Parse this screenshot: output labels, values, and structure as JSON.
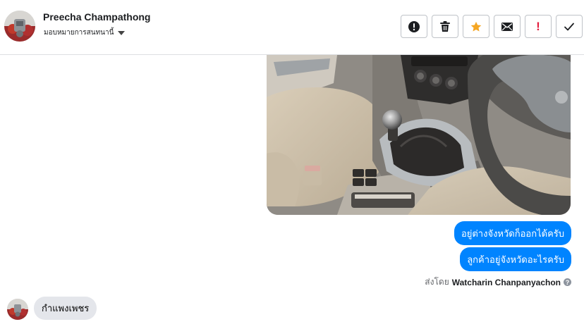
{
  "header": {
    "contact_name": "Preecha Champathong",
    "assign_label": "มอบหมายการสนทนานี้"
  },
  "actions": [
    {
      "name": "report-button",
      "icon": "exclamation-circle-icon"
    },
    {
      "name": "delete-button",
      "icon": "trash-icon"
    },
    {
      "name": "star-button",
      "icon": "star-icon",
      "color": "#f5a623"
    },
    {
      "name": "mark-unread-button",
      "icon": "envelope-icon"
    },
    {
      "name": "follow-up-button",
      "icon": "red-exclamation-icon",
      "color": "#e41e3f"
    },
    {
      "name": "mark-done-button",
      "icon": "check-icon"
    }
  ],
  "messages": {
    "outgoing": [
      "อยู่ต่างจังหวัดก็ออกได้ครับ",
      "ลูกค้าอยู่จังหวัดอะไรครับ"
    ],
    "sent_by_prefix": "ส่งโดย",
    "sent_by_name": "Watcharin Chanpanyachon",
    "incoming": "กำแพงเพชร"
  },
  "colors": {
    "outgoing_bubble": "#0084ff",
    "incoming_bubble": "#e4e6eb",
    "star": "#f5a623",
    "alert": "#e41e3f"
  }
}
